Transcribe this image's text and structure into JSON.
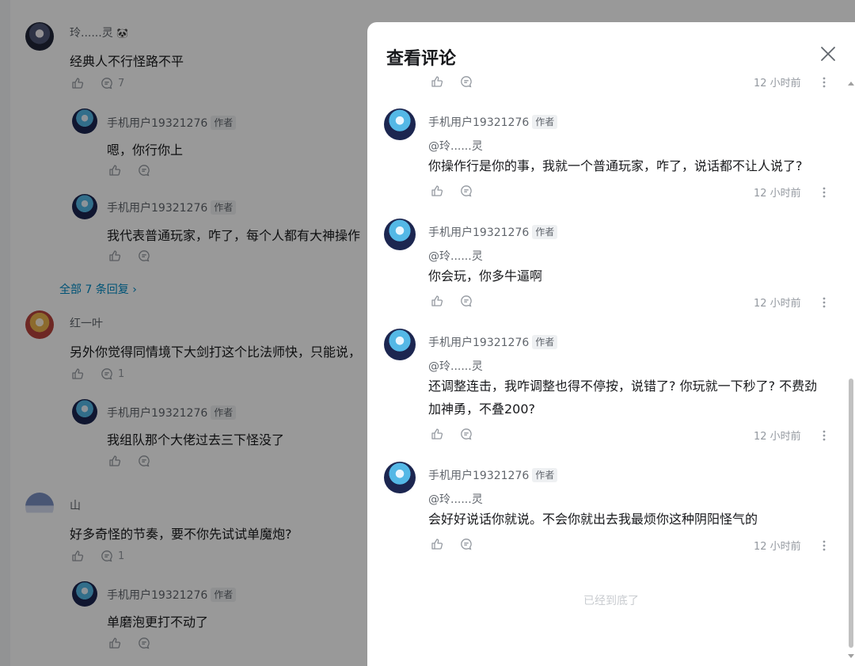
{
  "background_feed": {
    "comments": [
      {
        "user": "玲......灵",
        "text": "经典人不行怪路不平",
        "reply_count": "7",
        "replies": [
          {
            "user": "手机用户19321276",
            "tag": "作者",
            "text": "嗯，你行你上"
          },
          {
            "user": "手机用户19321276",
            "tag": "作者",
            "text": "我代表普通玩家，咋了，每个人都有大神操作"
          }
        ],
        "more_replies": "全部 7 条回复"
      },
      {
        "user": "红一叶",
        "text": "另外你觉得同情境下大剑打这个比法师快，只能说，",
        "reply_count": "1",
        "replies": [
          {
            "user": "手机用户19321276",
            "tag": "作者",
            "text": "我组队那个大佬过去三下怪没了"
          }
        ]
      },
      {
        "user": "山",
        "text": "好多奇怪的节奏，要不你先试试单魔炮?",
        "reply_count": "1",
        "replies": [
          {
            "user": "手机用户19321276",
            "tag": "作者",
            "text": "单磨泡更打不动了"
          }
        ]
      }
    ]
  },
  "modal": {
    "title": "查看评论",
    "top_partial": {
      "time": "12 小时前"
    },
    "comments": [
      {
        "user": "手机用户19321276",
        "tag": "作者",
        "at": "@玲......灵",
        "text": "你操作行是你的事，我就一个普通玩家，咋了，说话都不让人说了?",
        "time": "12 小时前"
      },
      {
        "user": "手机用户19321276",
        "tag": "作者",
        "at": "@玲......灵",
        "text": "你会玩，你多牛逼啊",
        "time": "12 小时前"
      },
      {
        "user": "手机用户19321276",
        "tag": "作者",
        "at": "@玲......灵",
        "text": "还调整连击，我咋调整也得不停按，说错了? 你玩就一下秒了? 不费劲加神勇，不叠200?",
        "time": "12 小时前"
      },
      {
        "user": "手机用户19321276",
        "tag": "作者",
        "at": "@玲......灵",
        "text": "会好好说话你就说。不会你就出去我最烦你这种阴阳怪气的",
        "time": "12 小时前"
      }
    ],
    "end_text": "已经到底了"
  },
  "icons": {
    "like": "thumbs-up-icon",
    "reply": "chat-bubble-icon",
    "more": "vertical-dots-icon",
    "close": "close-icon"
  },
  "colors": {
    "link": "#008ac5",
    "text": "#18191c",
    "muted": "#9499a0",
    "overlay": "rgba(0,0,0,0.40)"
  }
}
